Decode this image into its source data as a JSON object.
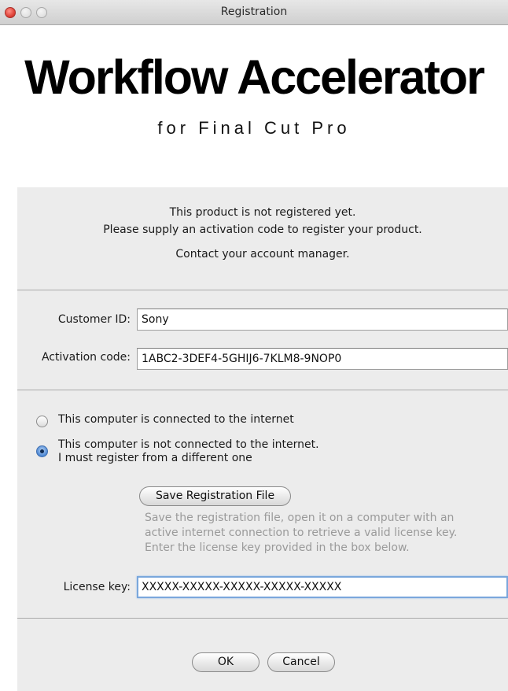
{
  "window": {
    "title": "Registration"
  },
  "header": {
    "title": "Workflow Accelerator",
    "subtitle": "for Final Cut Pro"
  },
  "info": {
    "line1": "This product is not registered yet.",
    "line2": "Please supply an activation code to register your product.",
    "line3": "Contact your account manager."
  },
  "fields": {
    "customer_id": {
      "label": "Customer ID:",
      "value": "Sony"
    },
    "activation_code": {
      "label": "Activation code:",
      "value": "1ABC2-3DEF4-5GHIJ6-7KLM8-9NOP0"
    },
    "license_key": {
      "label": "License key:",
      "value": "XXXXX-XXXXX-XXXXX-XXXXX-XXXXX"
    }
  },
  "connection": {
    "options": [
      {
        "label": "This computer is connected to the internet",
        "checked": false
      },
      {
        "label_line1": "This computer is not connected to the internet.",
        "label_line2": "I must register from a different one",
        "checked": true
      }
    ]
  },
  "offline": {
    "save_button": "Save Registration File",
    "hint_line1": "Save the registration file, open it on a computer with an",
    "hint_line2": "active internet connection to retrieve a valid license key.",
    "hint_line3": "Enter the license key provided in the box below."
  },
  "buttons": {
    "ok": "OK",
    "cancel": "Cancel"
  }
}
